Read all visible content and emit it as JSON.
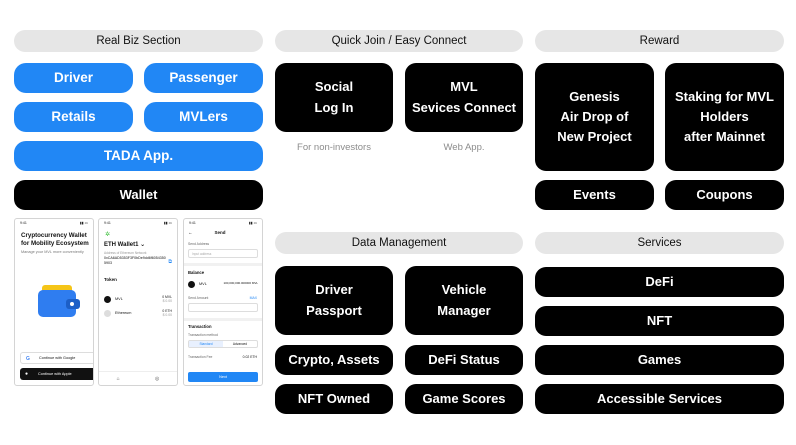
{
  "sections": {
    "real_biz": {
      "header": "Real Biz Section",
      "driver": "Driver",
      "passenger": "Passenger",
      "retails": "Retails",
      "mvlers": "MVLers",
      "tada": "TADA App.",
      "wallet": "Wallet"
    },
    "quick_join": {
      "header": "Quick Join / Easy Connect",
      "social": "Social\nLog In",
      "mvl_connect": "MVL\nSevices Connect",
      "caption_social": "For non-investors",
      "caption_mvl": "Web App."
    },
    "reward": {
      "header": "Reward",
      "genesis": "Genesis\nAir Drop of\nNew Project",
      "staking": "Staking for MVL\nHolders\nafter Mainnet",
      "events": "Events",
      "coupons": "Coupons"
    },
    "data_management": {
      "header": "Data Management",
      "driver_passport": "Driver\nPassport",
      "vehicle_manager": "Vehicle\nManager",
      "crypto_assets": "Crypto, Assets",
      "defi_status": "DeFi Status",
      "nft_owned": "NFT Owned",
      "game_scores": "Game Scores"
    },
    "services": {
      "header": "Services",
      "defi": "DeFi",
      "nft": "NFT",
      "games": "Games",
      "accessible": "Accessible Services"
    }
  },
  "phones": {
    "time": "9:41",
    "p1": {
      "title": "Cryptocurrency Wallet for Mobility Ecosystem",
      "subtitle": "Manage your MVL more conveniently",
      "google": "Continue with Google",
      "apple": "Continue with Apple"
    },
    "p2": {
      "title": "ETH Wallet1 ⌄",
      "addr_label": "Address of Ethereum Network",
      "address": "0xCA6AD5353F3F0bDe9dd6f6054350 5903",
      "token_header": "Token",
      "tokens": [
        {
          "name": "MVL",
          "amount": "0 MVL",
          "fiat": "$ 0.00"
        },
        {
          "name": "Ethereum",
          "amount": "0 ETH",
          "fiat": "$ 0.00"
        }
      ]
    },
    "p3": {
      "title": "Send",
      "send_address_label": "Send Address",
      "send_address_placeholder": "Input address",
      "balance_header": "Balance",
      "token": "MVL",
      "balance": "100,000,000.000000 MVL",
      "send_amount_label": "Send Amount",
      "max": "MAX",
      "tx_header": "Transaction",
      "tx_method": "Transaction method",
      "standard": "Standard",
      "advanced": "Advanced",
      "tx_fee": "Transaction Fee",
      "fee": "0.02 ETH",
      "next": "Next"
    }
  }
}
